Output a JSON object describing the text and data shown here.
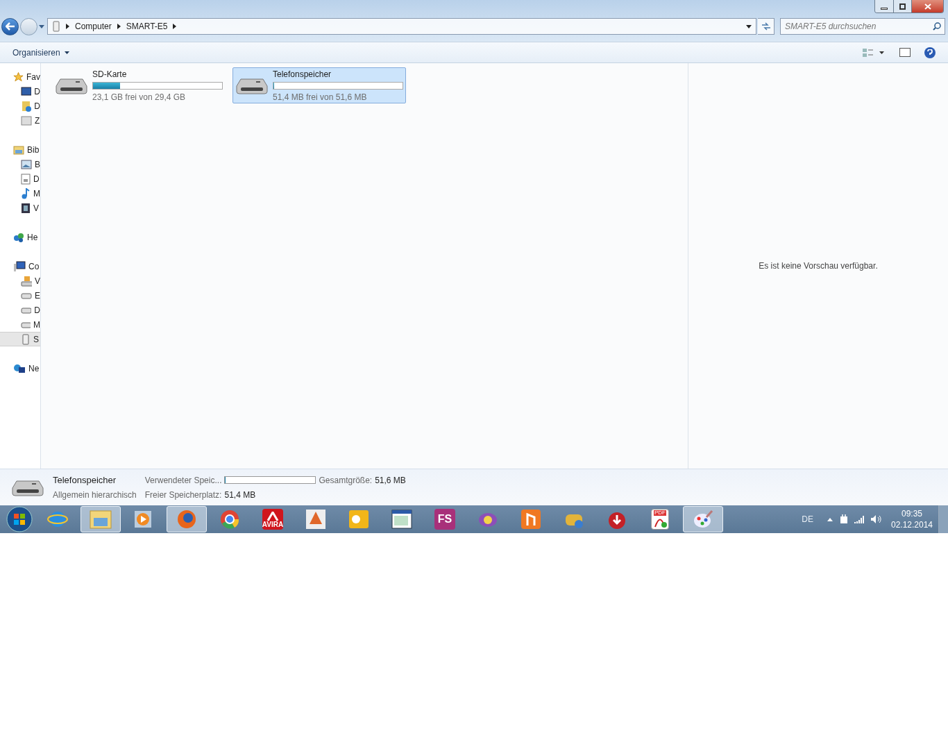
{
  "address_bar": {
    "crumbs": [
      "Computer",
      "SMART-E5"
    ],
    "search": {
      "placeholder": "SMART-E5 durchsuchen"
    }
  },
  "toolbar": {
    "organize": "Organisieren"
  },
  "sidebar": {
    "items": [
      {
        "label": "Fav",
        "kind": "star",
        "selected": false,
        "children": [
          {
            "label": "D",
            "kind": "desktop",
            "selected": false
          },
          {
            "label": "D",
            "kind": "downloads",
            "selected": false
          },
          {
            "label": "Z",
            "kind": "recent",
            "selected": false
          }
        ]
      },
      {
        "label": "Bib",
        "kind": "library",
        "selected": false,
        "children": [
          {
            "label": "B",
            "kind": "pictures",
            "selected": false
          },
          {
            "label": "D",
            "kind": "document",
            "selected": false
          },
          {
            "label": "M",
            "kind": "music",
            "selected": false
          },
          {
            "label": "V",
            "kind": "video",
            "selected": false
          }
        ]
      },
      {
        "label": "He",
        "kind": "homegroup",
        "selected": false
      },
      {
        "label": "Co",
        "kind": "computer",
        "selected": false,
        "children": [
          {
            "label": "V",
            "kind": "windrive",
            "selected": false
          },
          {
            "label": "E",
            "kind": "drive",
            "selected": false
          },
          {
            "label": "D",
            "kind": "drive",
            "selected": false
          },
          {
            "label": "M",
            "kind": "drive",
            "selected": false
          },
          {
            "label": "S",
            "kind": "device",
            "selected": true
          }
        ]
      },
      {
        "label": "Ne",
        "kind": "network",
        "selected": false
      }
    ]
  },
  "drives": [
    {
      "name": "SD-Karte",
      "level": 0.21,
      "free": "23,1 GB frei von 29,4 GB",
      "selected": false
    },
    {
      "name": "Telefonspeicher",
      "level": 0.004,
      "free": "51,4 MB frei von 51,6 MB",
      "selected": true
    }
  ],
  "preview": {
    "message": "Es ist keine Vorschau verfügbar."
  },
  "details": {
    "name": "Telefonspeicher",
    "type": "Allgemein hierarchisch",
    "used_label": "Verwendeter Speic...",
    "used_bar": {
      "level": 0.004
    },
    "total_label": "Gesamtgröße:",
    "total_value": "51,6 MB",
    "free_label": "Freier Speicherplatz:",
    "free_value": "51,4 MB"
  },
  "taskbar": {
    "apps": [
      {
        "kind": "ie",
        "active": false
      },
      {
        "kind": "explorer",
        "active": true
      },
      {
        "kind": "media",
        "active": false
      },
      {
        "kind": "firefox",
        "active": true
      },
      {
        "kind": "chrome",
        "active": false
      },
      {
        "kind": "avira",
        "label": "AVIRA",
        "active": false
      },
      {
        "kind": "app",
        "active": false
      },
      {
        "kind": "outlook",
        "active": false
      },
      {
        "kind": "window",
        "active": false
      },
      {
        "kind": "fs",
        "label": "FS",
        "active": false
      },
      {
        "kind": "messenger",
        "active": false
      },
      {
        "kind": "notes",
        "active": false
      },
      {
        "kind": "game",
        "active": false
      },
      {
        "kind": "download",
        "active": false
      },
      {
        "kind": "pdf",
        "label": "PDF",
        "active": false
      },
      {
        "kind": "paint",
        "active": true
      }
    ],
    "language": "DE",
    "time": "09:35",
    "date": "02.12.2014"
  }
}
